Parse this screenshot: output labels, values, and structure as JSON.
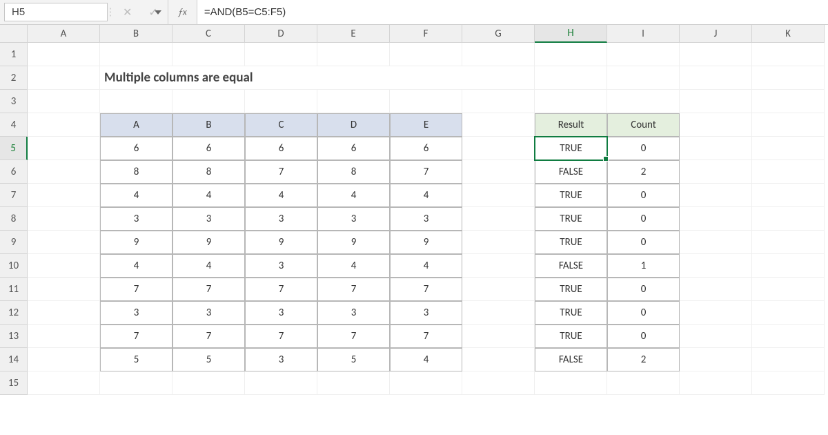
{
  "namebox": "H5",
  "formula": "=AND(B5=C5:F5)",
  "title_cell": "Multiple columns are equal",
  "columns": [
    "A",
    "B",
    "C",
    "D",
    "E",
    "F",
    "G",
    "H",
    "I",
    "J",
    "K"
  ],
  "rows": [
    "1",
    "2",
    "3",
    "4",
    "5",
    "6",
    "7",
    "8",
    "9",
    "10",
    "11",
    "12",
    "13",
    "14",
    "15"
  ],
  "active": {
    "col": "H",
    "row": "5"
  },
  "table1": {
    "headers": [
      "A",
      "B",
      "C",
      "D",
      "E"
    ],
    "rows": [
      [
        "6",
        "6",
        "6",
        "6",
        "6"
      ],
      [
        "8",
        "8",
        "7",
        "8",
        "7"
      ],
      [
        "4",
        "4",
        "4",
        "4",
        "4"
      ],
      [
        "3",
        "3",
        "3",
        "3",
        "3"
      ],
      [
        "9",
        "9",
        "9",
        "9",
        "9"
      ],
      [
        "4",
        "4",
        "3",
        "4",
        "4"
      ],
      [
        "7",
        "7",
        "7",
        "7",
        "7"
      ],
      [
        "3",
        "3",
        "3",
        "3",
        "3"
      ],
      [
        "7",
        "7",
        "7",
        "7",
        "7"
      ],
      [
        "5",
        "5",
        "3",
        "5",
        "4"
      ]
    ]
  },
  "table2": {
    "headers": [
      "Result",
      "Count"
    ],
    "rows": [
      [
        "TRUE",
        "0"
      ],
      [
        "FALSE",
        "2"
      ],
      [
        "TRUE",
        "0"
      ],
      [
        "TRUE",
        "0"
      ],
      [
        "TRUE",
        "0"
      ],
      [
        "FALSE",
        "1"
      ],
      [
        "TRUE",
        "0"
      ],
      [
        "TRUE",
        "0"
      ],
      [
        "TRUE",
        "0"
      ],
      [
        "FALSE",
        "2"
      ]
    ]
  }
}
